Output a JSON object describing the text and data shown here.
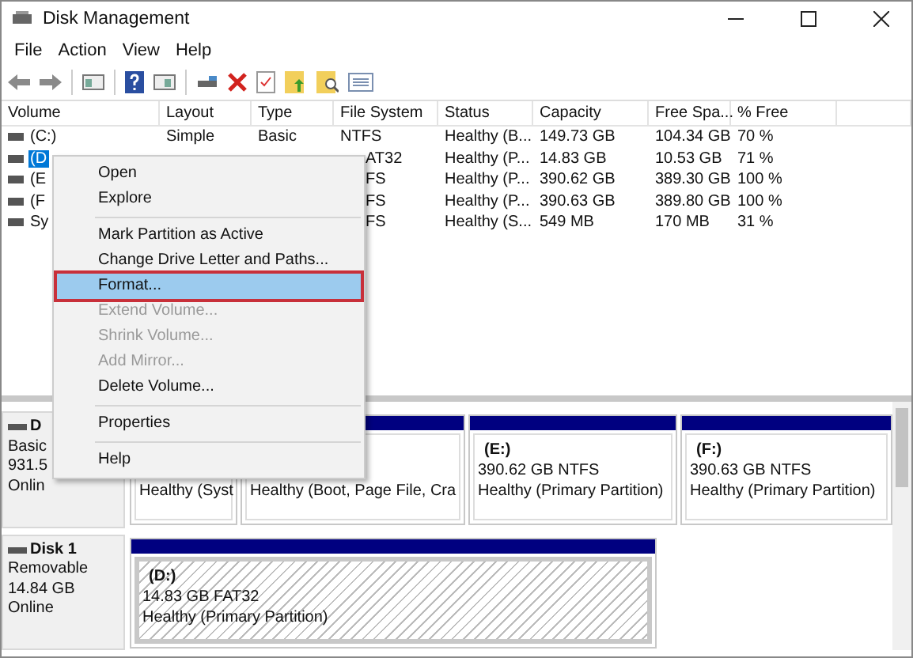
{
  "window": {
    "title": "Disk Management"
  },
  "menu_bar": [
    "File",
    "Action",
    "View",
    "Help"
  ],
  "volume_table": {
    "columns": [
      "Volume",
      "Layout",
      "Type",
      "File System",
      "Status",
      "Capacity",
      "Free Spa...",
      "% Free"
    ],
    "rows": [
      {
        "volume": "(C:)",
        "layout": "Simple",
        "type": "Basic",
        "file_system": "NTFS",
        "status": "Healthy (B...",
        "capacity": "149.73 GB",
        "free_space": "104.34 GB",
        "percent_free": "70 %",
        "selected": false
      },
      {
        "volume": "(D",
        "file_system": "AT32",
        "status": "Healthy (P...",
        "capacity": "14.83 GB",
        "free_space": "10.53 GB",
        "percent_free": "71 %",
        "selected": true
      },
      {
        "volume": "(E",
        "file_system": "FS",
        "status": "Healthy (P...",
        "capacity": "390.62 GB",
        "free_space": "389.30 GB",
        "percent_free": "100 %",
        "selected": false
      },
      {
        "volume": "(F",
        "file_system": "FS",
        "status": "Healthy (P...",
        "capacity": "390.63 GB",
        "free_space": "389.80 GB",
        "percent_free": "100 %",
        "selected": false
      },
      {
        "volume": "Sy",
        "file_system": "FS",
        "status": "Healthy (S...",
        "capacity": "549 MB",
        "free_space": "170 MB",
        "percent_free": "31 %",
        "selected": false
      }
    ]
  },
  "context_menu": [
    {
      "kind": "item",
      "label": "Open",
      "disabled": false,
      "selected": false
    },
    {
      "kind": "item",
      "label": "Explore",
      "disabled": false,
      "selected": false
    },
    {
      "kind": "separator"
    },
    {
      "kind": "item",
      "label": "Mark Partition as Active",
      "disabled": false,
      "selected": false
    },
    {
      "kind": "item",
      "label": "Change Drive Letter and Paths...",
      "disabled": false,
      "selected": false
    },
    {
      "kind": "item",
      "label": "Format...",
      "disabled": false,
      "selected": true
    },
    {
      "kind": "item",
      "label": "Extend Volume...",
      "disabled": true,
      "selected": false
    },
    {
      "kind": "item",
      "label": "Shrink Volume...",
      "disabled": true,
      "selected": false
    },
    {
      "kind": "item",
      "label": "Add Mirror...",
      "disabled": true,
      "selected": false
    },
    {
      "kind": "item",
      "label": "Delete Volume...",
      "disabled": false,
      "selected": false
    },
    {
      "kind": "separator"
    },
    {
      "kind": "item",
      "label": "Properties",
      "disabled": false,
      "selected": false
    },
    {
      "kind": "separator"
    },
    {
      "kind": "item",
      "label": "Help",
      "disabled": false,
      "selected": false
    }
  ],
  "disks": [
    {
      "name": "D",
      "type": "Basic",
      "size": "931.5",
      "status": "Onlin",
      "partitions": [
        {
          "status": "Healthy (Syst",
          "selected": false
        },
        {
          "status": "Healthy (Boot, Page File, Cra",
          "selected": false
        },
        {
          "label": "(E:)",
          "size": "390.62 GB NTFS",
          "status": "Healthy (Primary Partition)",
          "selected": false
        },
        {
          "label": "(F:)",
          "size": "390.63 GB NTFS",
          "status": "Healthy (Primary Partition)",
          "selected": false
        }
      ]
    },
    {
      "name": "Disk 1",
      "type": "Removable",
      "size": "14.84 GB",
      "status": "Online",
      "partitions": [
        {
          "label": "(D:)",
          "size": "14.83 GB FAT32",
          "status": "Healthy (Primary Partition)",
          "selected": true
        }
      ]
    }
  ]
}
